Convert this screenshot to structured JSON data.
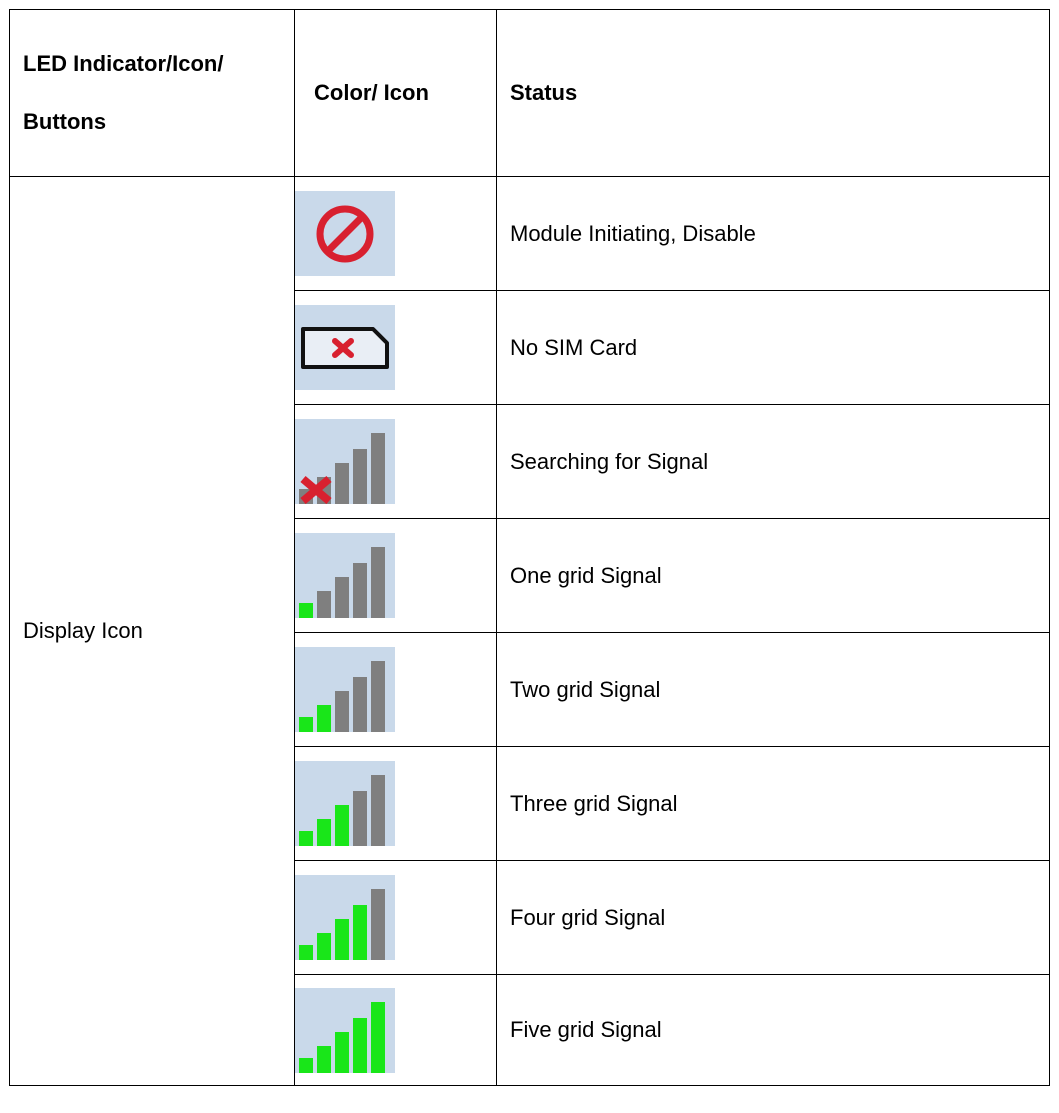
{
  "table": {
    "headers": {
      "col1_lines": [
        "LED Indicator/Icon/",
        "Buttons"
      ],
      "col2": "Color/ Icon",
      "col3": "Status"
    },
    "group_label": "Display Icon",
    "rows": [
      {
        "icon": "disable-icon",
        "status": "Module Initiating, Disable"
      },
      {
        "icon": "no-sim-card-icon",
        "status": "No SIM Card"
      },
      {
        "icon": "searching-signal-icon",
        "status": "Searching for Signal"
      },
      {
        "icon": "signal-1-bar-icon",
        "status": "One grid Signal",
        "level": 1
      },
      {
        "icon": "signal-2-bars-icon",
        "status": "Two grid Signal",
        "level": 2
      },
      {
        "icon": "signal-3-bars-icon",
        "status": "Three grid Signal",
        "level": 3
      },
      {
        "icon": "signal-4-bars-icon",
        "status": "Four grid Signal",
        "level": 4
      },
      {
        "icon": "signal-5-bars-icon",
        "status": "Five grid Signal",
        "level": 5
      }
    ]
  },
  "colors": {
    "icon_background": "#c9d9ea",
    "bar_active": "#19e619",
    "bar_inactive": "#7f7f7f",
    "red": "#d8202f"
  }
}
